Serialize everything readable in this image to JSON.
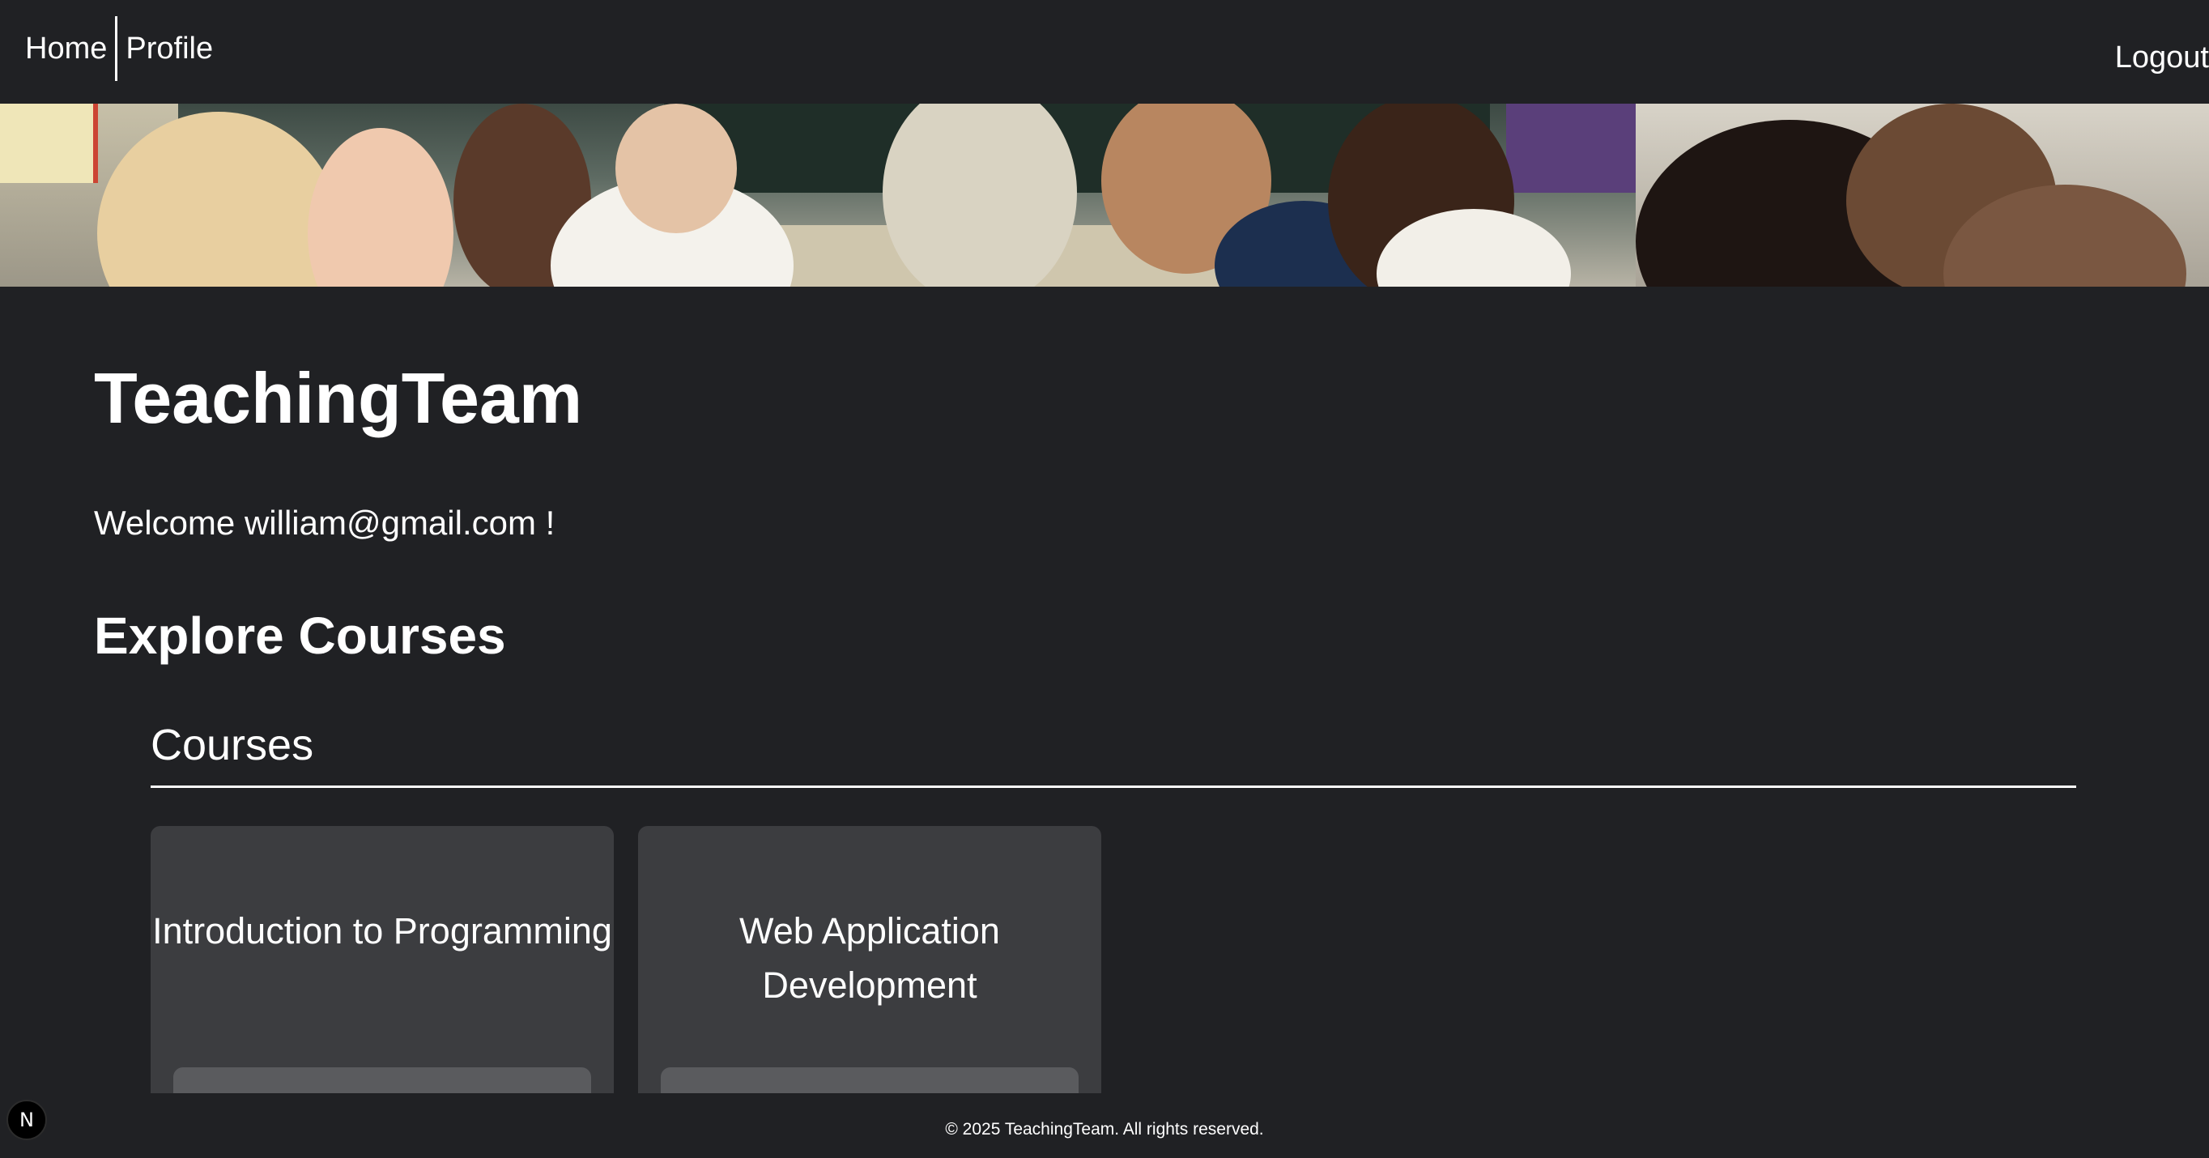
{
  "nav": {
    "home_label": "Home",
    "profile_label": "Profile",
    "logout_label": "Logout"
  },
  "main": {
    "title": "TeachingTeam",
    "welcome_text": "Welcome william@gmail.com !",
    "explore_heading": "Explore Courses",
    "courses_heading": "Courses",
    "courses": [
      {
        "title": "Introduction to Programming"
      },
      {
        "title": "Web Application Development"
      }
    ]
  },
  "footer": {
    "copyright": "© 2025 TeachingTeam. All rights reserved."
  },
  "dev_indicator": {
    "label": "N"
  },
  "colors": {
    "background": "#202124",
    "card_background": "#3c3d40",
    "card_footer": "#5a5b5e",
    "text": "#ffffff"
  }
}
